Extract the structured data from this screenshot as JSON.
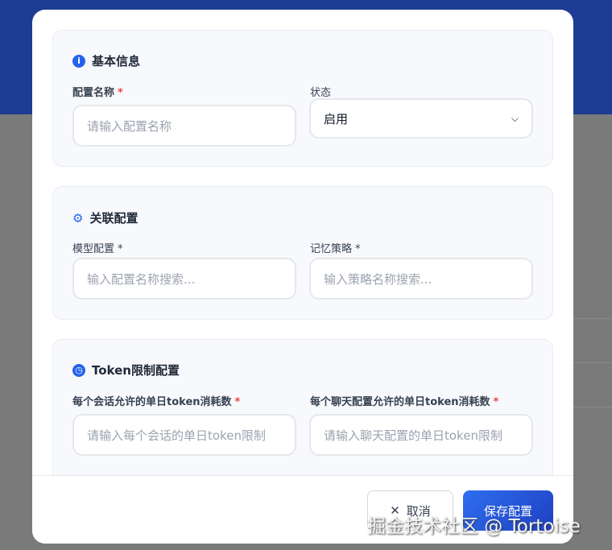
{
  "basic": {
    "title": "基本信息",
    "name_label": "配置名称",
    "name_placeholder": "请输入配置名称",
    "status_label": "状态",
    "status_value": "启用"
  },
  "relation": {
    "title": "关联配置",
    "model_label": "模型配置",
    "model_placeholder": "输入配置名称搜索...",
    "memory_label": "记忆策略",
    "memory_placeholder": "输入策略名称搜索..."
  },
  "token": {
    "title": "Token限制配置",
    "session_label": "每个会话允许的单日token消耗数",
    "session_placeholder": "请输入每个会话的单日token限制",
    "chat_label": "每个聊天配置允许的单日token消耗数",
    "chat_placeholder": "请输入聊天配置的单日token限制"
  },
  "required_mark": "*",
  "footer": {
    "cancel": "取消",
    "save": "保存配置"
  },
  "watermark": "掘金技术社区 @ Tortoise"
}
